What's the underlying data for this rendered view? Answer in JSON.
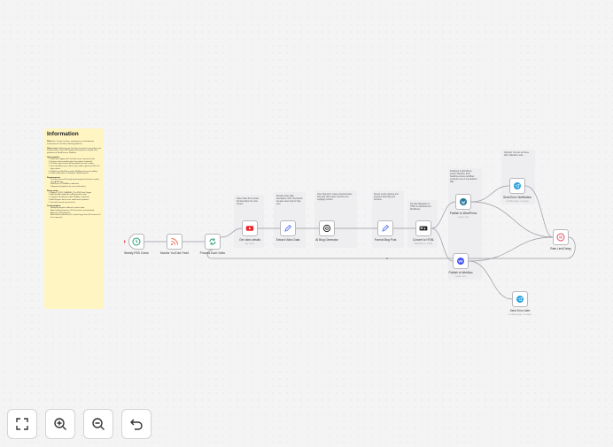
{
  "sticky_main": {
    "title": "Information",
    "what_it_is_label": "What it Is:",
    "what_it_is": "Content creation, repurposing, and distribution automation for YouTube and blog platforms.",
    "what_it_does_label": "What it does:",
    "what_it_does": "Monitors your YouTube channel for new videos and automatically creates SEO-optimized blog posts using AI, then publishes to WordPress or Webflow.",
    "how_it_works_label": "How it works:",
    "how_it_works": [
      "RSS Feed Trigger polls YouTube every X amount of time",
      "Extracts video metadata (title, description, thumbnail)",
      "YouTube node extracts full description for extra context",
      "Uses OpenAI (or your choice) any model to generate SEO-rich blog content",
      "Publishes to WordPress and/or Webflow with error handling",
      "Sends notifications to Telegram if publishing fails"
    ],
    "requirements_label": "Requirements:",
    "requirements": [
      "YouTube channel ID (easily found anywhere for better results)",
      "OpenAI API key",
      "WordPress OR Webflow credentials",
      "Telegram bot (optional, for error notifications)"
    ],
    "setup_label": "Setup steps:",
    "setup": [
      "Replace YOUR_CHANNEL_ID in RSS Feed Trigger",
      "Add OpenAI credentials to AI generation node",
      "Configure WordPress and/or Webflow credentials",
      "Add Telegram bot for error notifications (optional)",
      "Test with manual execution first"
    ],
    "customization_label": "Customization:",
    "customization": [
      "Modify AI prompt for different content styles",
      "Adjust polling frequency (15-30 minutes recommended)",
      "Add more CMS platforms",
      "Add content verification (ie: content longer than 500 characters? If not, improve)"
    ]
  },
  "mini_notes": {
    "get_video": "Video Video ID is extract full description for extra context",
    "extract": "Extracts video data, description, URL, thumbnails. Creates clean slug for blog post",
    "ai_gen": "Uses OpenAI to create comprehensive blog post with proper structure and engaging content",
    "format": "Cleans up AI response and prepares final blog post structure",
    "html": "Formats Markdown to HTML for Webflow and WordPress",
    "wp": "Published to WordPress section Webflow. Error handling ensures workflow continues even if one platform fails",
    "err_top": "Optional: You can set these with notification node"
  },
  "nodes": [
    {
      "id": "rss",
      "label": "Weekly RSS Check",
      "sub": "",
      "icon": "clock-icon",
      "color": "#22a06b"
    },
    {
      "id": "monitor",
      "label": "Monitor YouTube Feed",
      "sub": "",
      "icon": "rss-icon",
      "color": "#f26c4f"
    },
    {
      "id": "each",
      "label": "Process Each Video",
      "sub": "",
      "icon": "loop-icon",
      "color": "#22a06b"
    },
    {
      "id": "details",
      "label": "Get video details",
      "sub": "get: video",
      "icon": "youtube-icon",
      "color": "#e8262b"
    },
    {
      "id": "extract",
      "label": "Extract Video Data",
      "sub": "",
      "icon": "pencil-icon",
      "color": "#4e6ef2"
    },
    {
      "id": "ai",
      "label": "AI Blog Generator",
      "sub": "",
      "icon": "openai-icon",
      "color": "#222222"
    },
    {
      "id": "format",
      "label": "Format Blog Post",
      "sub": "",
      "icon": "pencil-icon",
      "color": "#4e6ef2"
    },
    {
      "id": "html",
      "label": "Convert to HTML",
      "sub": "Markdown to HTML",
      "icon": "markdown-icon",
      "color": "#222222"
    },
    {
      "id": "wp",
      "label": "Publish to WordPress",
      "sub": "create: post",
      "icon": "wordpress-icon",
      "color": "#21759b"
    },
    {
      "id": "wf",
      "label": "Publish to Webflow",
      "sub": "create: item",
      "icon": "webflow-icon",
      "color": "#4353ff"
    },
    {
      "id": "errtop",
      "label": "Send Error Notification",
      "sub": "sendMessage: message",
      "icon": "telegram-icon",
      "color": "#2aa3de"
    },
    {
      "id": "limit",
      "label": "Rate Limit Delay",
      "sub": "",
      "icon": "pause-icon",
      "color": "#e34f6a"
    },
    {
      "id": "errbot",
      "label": "Send Error Alert",
      "sub": "sendMessage: message",
      "icon": "telegram-icon",
      "color": "#2aa3de"
    }
  ],
  "controls": [
    {
      "id": "fit",
      "icon": "fit-view-icon"
    },
    {
      "id": "zoomin",
      "icon": "zoom-in-icon"
    },
    {
      "id": "zoomout",
      "icon": "zoom-out-icon"
    },
    {
      "id": "undo",
      "icon": "undo-icon"
    }
  ]
}
